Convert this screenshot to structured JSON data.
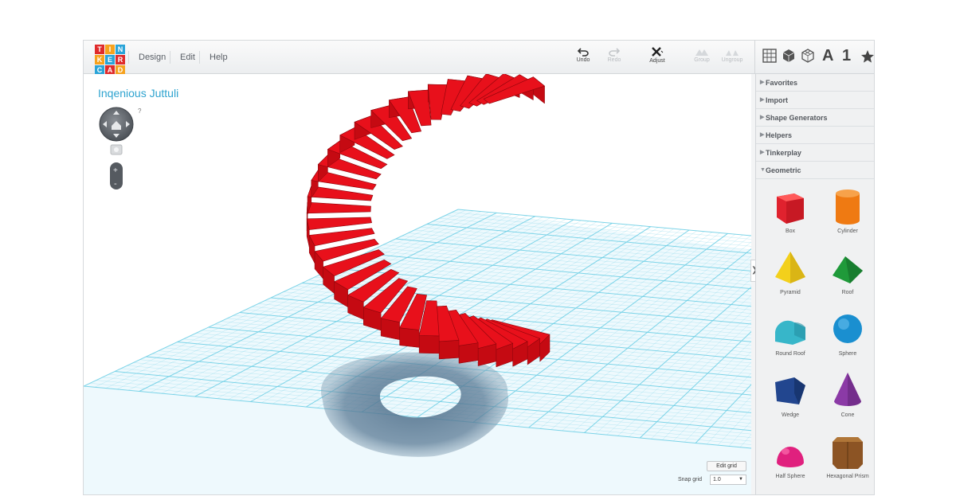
{
  "logo": {
    "letters": [
      "T",
      "I",
      "N",
      "K",
      "E",
      "R",
      "C",
      "A",
      "D"
    ],
    "colors": [
      "#e02b2b",
      "#f6a21e",
      "#2aa4d8",
      "#f6a21e",
      "#2aa4d8",
      "#e02b2b",
      "#2aa4d8",
      "#e02b2b",
      "#f6a21e"
    ]
  },
  "menu": {
    "design": "Design",
    "edit": "Edit",
    "help": "Help"
  },
  "toolbar": {
    "undo": "Undo",
    "redo": "Redo",
    "adjust": "Adjust",
    "group": "Group",
    "ungroup": "Ungroup"
  },
  "view": {
    "text_icon": "A",
    "number_icon": "1"
  },
  "design": {
    "title": "Inqenious Juttuli"
  },
  "nav": {
    "help_mark": "?"
  },
  "sidebar": {
    "categories": [
      "Favorites",
      "Import",
      "Shape Generators",
      "Helpers",
      "Tinkerplay",
      "Geometric"
    ],
    "shapes": [
      {
        "label": "Box",
        "color": "#e0222e"
      },
      {
        "label": "Cylinder",
        "color": "#ef7a12"
      },
      {
        "label": "Pyramid",
        "color": "#f3d01b"
      },
      {
        "label": "Roof",
        "color": "#1f9a3a"
      },
      {
        "label": "Round Roof",
        "color": "#37b6c9"
      },
      {
        "label": "Sphere",
        "color": "#1a8fd0"
      },
      {
        "label": "Wedge",
        "color": "#22468f"
      },
      {
        "label": "Cone",
        "color": "#8b3aa6"
      },
      {
        "label": "Half Sphere",
        "color": "#e0207e"
      },
      {
        "label": "Hexagonal Prism",
        "color": "#8c5424"
      }
    ]
  },
  "grid": {
    "edit_label": "Edit grid",
    "snap_label": "Snap grid",
    "snap_value": "1.0"
  },
  "colors": {
    "accent": "#2ea3cf",
    "stair": "#e8101b",
    "grid": "#6fcfe6"
  }
}
